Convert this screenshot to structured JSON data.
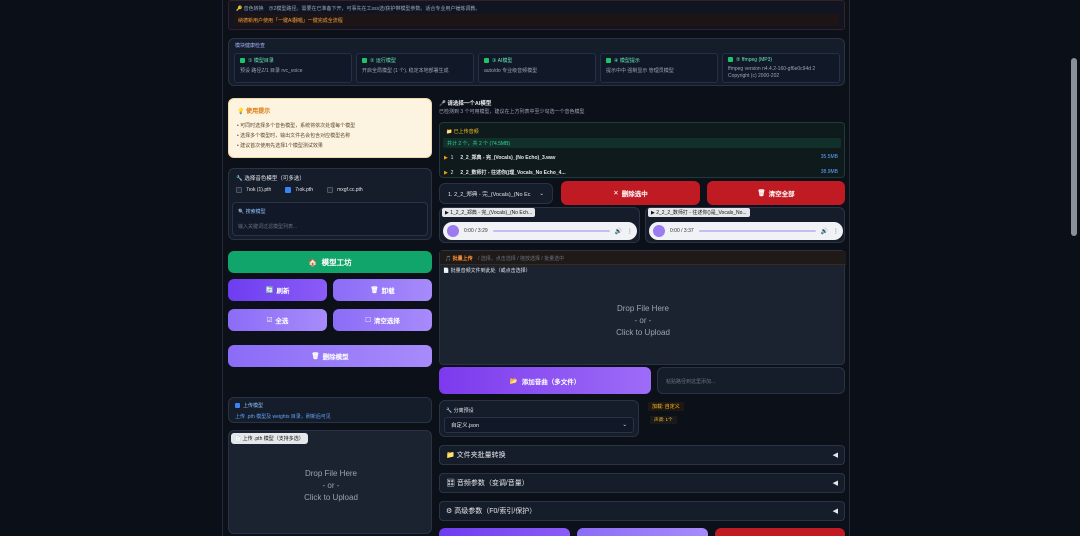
{
  "top": {
    "line1_label": "音色转换",
    "line1_text": "示2模型路径。需要在已准备下开，可事先在工sss选/获护带模型参数。适合专业用户锤炼调教。",
    "warning": "纳德新用户使用「一键AI翻唱」一键完成全流程"
  },
  "info": {
    "header": "模块健康检查",
    "cards": [
      {
        "t": "① 模型目录",
        "d": "预设 路径Z/1 目录 rvc_voice"
      },
      {
        "t": "② 运行模型",
        "d": "开启全局模型 (1 个), 稳定本地部署生成"
      },
      {
        "t": "③ AI模型",
        "d": "auto/do 专业级音频模型"
      },
      {
        "t": "④ 模型提示",
        "d": "提示中中 强制显示 管理员模型"
      },
      {
        "t": "⑤ ffmpeg (MP3)",
        "d": "ffmpeg version n4.4.2-160-gf6e0c94d 2 Copyright (c) 2000-202"
      }
    ]
  },
  "tips": {
    "title": "使用提示",
    "items": [
      "• 可同时选择多个音色模型，系统将依次处理每个模型",
      "• 选择多个模型时，输出文件名会包含对应模型名称",
      "• 建议首次使用先选择1个模型测试效果"
    ]
  },
  "models": {
    "title": "选择音色模型（可多选）",
    "items": [
      "7ıok (1).pth",
      "7ıok.pth",
      "mxgf.cc.pth"
    ],
    "checked": [
      false,
      true,
      false
    ],
    "search_title": "搜索模型",
    "search_placeholder": "输入关键词过滤模型列表..."
  },
  "left_buttons": {
    "workshop": "模型工坊",
    "refresh": "刷新",
    "unload": "卸载",
    "select_all": "全选",
    "clear": "清空选择",
    "delete": "删除模型"
  },
  "upload_model": {
    "title": "上传模型",
    "desc": "上传 .pth 模型及 weights 目录，刷新后可见",
    "tab": "上传 .pth 模型（支持多选）",
    "drop1": "Drop File Here",
    "drop2": "- or -",
    "drop3": "Click to Upload"
  },
  "song": {
    "title": "请选择一个AI模型",
    "subtitle": "已检测到 3 个可用模型，建议在上方列表中至少勾选一个音色模型",
    "uploaded_label": "已上传音频",
    "uploaded_info": "共计 2 个，共 2 个 (74.5MB)",
    "files": [
      {
        "n": "1",
        "name": "2_2_郑典 - 完_(Vocals)_(No Echo)_3.wav",
        "size": "35.5MB"
      },
      {
        "n": "2",
        "name": "2_2_数师打 - 往述你()理_Vocals_No Echo_4...",
        "size": "38.9MB"
      }
    ],
    "select_value": "1. 2_2_郑典 - 完_(Vocals)_(No Ec",
    "delete_selected": "删除选中",
    "clear_all": "清空全部"
  },
  "players": [
    {
      "label": "▶ 1_2_2_郑典 - 完_(Vocals)_(No Ech...",
      "time": "0:00 / 3:29"
    },
    {
      "label": "▶ 2_2_2_数师打 - 往述你()是_Vocals_No...",
      "time": "0:00 / 3:37"
    }
  ],
  "batch": {
    "title": "批量上传",
    "subtitle": "/ 选择，点击选择 / 拖放选择 / 批量选中",
    "tab": "批量音频文件到此处（或点击选择）",
    "drop1": "Drop File Here",
    "drop2": "- or -",
    "drop3": "Click to Upload",
    "add_button": "添加音曲（多文件）",
    "path_placeholder": "粘贴路径到这里添加..."
  },
  "preset": {
    "title": "分离预设",
    "value": "自定义.json",
    "status": "加载: 自定义",
    "status2": "声调: 1个"
  },
  "folds": {
    "folder": "文件夹批量转换",
    "audio": "音频参数（变调/音量）",
    "advanced": "高级参数（F0/索引/保护）"
  },
  "colors": {
    "accent": "#8b5cf6",
    "green": "#12a56b",
    "red": "#c01b22"
  }
}
